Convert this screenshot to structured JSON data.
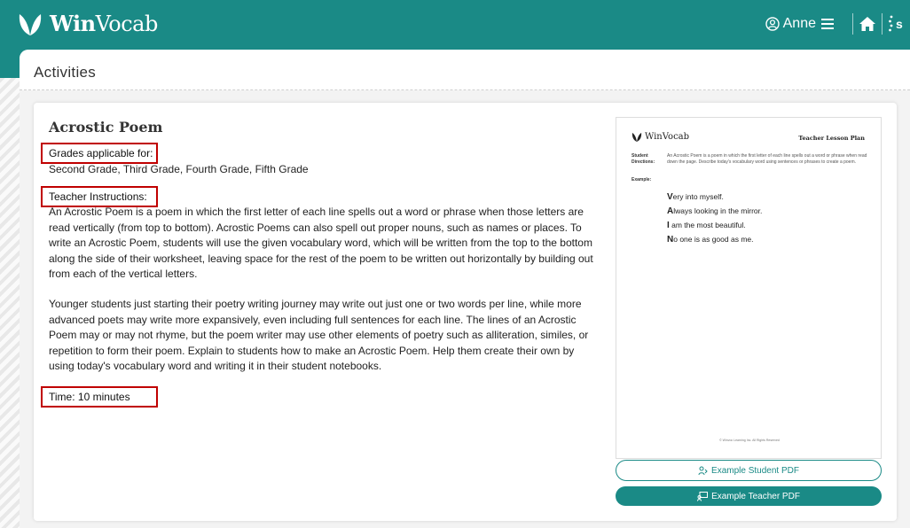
{
  "header": {
    "logo_icon": "winvocab-leaf-icon",
    "logo_bold": "Win",
    "logo_regular": "Vocab",
    "user_name": "Anne",
    "icons": [
      "user-circle-icon",
      "hamburger-menu-icon",
      "home-icon",
      "s-brand-icon"
    ]
  },
  "page": {
    "title": "Activities"
  },
  "activity": {
    "title": "Acrostic Poem",
    "grades_label": "Grades applicable for:",
    "grades": "Second Grade, Third Grade, Fourth Grade, Fifth Grade",
    "instructions_label": "Teacher Instructions:",
    "paragraph1": "An Acrostic Poem is a poem in which the first letter of each line spells out a word or phrase when those letters are read vertically (from top to bottom). Acrostic Poems can also spell out proper nouns, such as names or places. To write an Acrostic Poem, students will use the given vocabulary word, which will be written from the top to the bottom along the side of their worksheet, leaving space for the rest of the poem to be written out horizontally by building out from each of the vertical letters.",
    "paragraph2": "Younger students just starting their poetry writing journey may write out just one or two words per line, while more advanced poets may write more expansively, even including full sentences for each line. The lines of an Acrostic Poem may or may not rhyme, but the poem writer may use other elements of poetry such as alliteration, similes, or repetition to form their poem. Explain to students how to make an Acrostic Poem. Help them create their own by using today's vocabulary word and writing it in their student notebooks.",
    "time": "Time: 10 minutes"
  },
  "preview": {
    "logo": "WinVocab",
    "heading": "Teacher Lesson Plan",
    "directions_label_1": "Student",
    "directions_label_2": "Directions:",
    "directions": "An Acrostic Poem is a poem in which the first letter of each line spells out a word or phrase when read down the page. Describe today's vocabulary word using sentences or phrases to create a poem.",
    "example_label": "Example:",
    "poem": [
      {
        "initial": "V",
        "rest": "ery into myself."
      },
      {
        "initial": "A",
        "rest": "lways looking in the mirror."
      },
      {
        "initial": "I",
        "rest": " am the most beautiful."
      },
      {
        "initial": "N",
        "rest": "o one is as good as me."
      }
    ],
    "copyright": "© Winvoc Learning Inc. All Rights Reserved"
  },
  "buttons": {
    "student_pdf": "Example Student PDF",
    "teacher_pdf": "Example Teacher PDF"
  },
  "colors": {
    "brand_teal": "#1a8a86",
    "highlight_red": "#c00000"
  }
}
